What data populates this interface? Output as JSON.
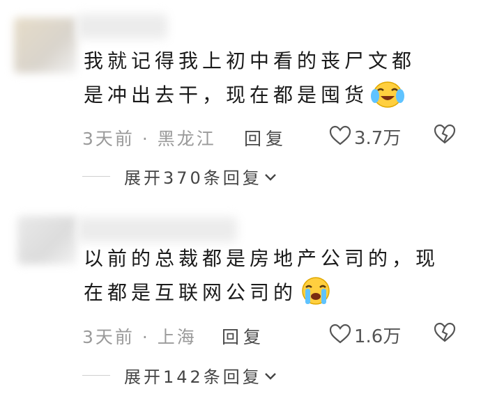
{
  "comments": [
    {
      "line1": "我就记得我上初中看的丧尸文都",
      "line2": "是冲出去干，现在都是囤货",
      "location": "3天前 · 黑龙江",
      "reply_label": "回复",
      "likes": "3.7万",
      "expand_label": "展开370条回复",
      "emoji": "laugh-cry-emoji"
    },
    {
      "line1": "以前的总裁都是房地产公司的，现",
      "line2": "在都是互联网公司的",
      "location": "3天前 · 上海",
      "reply_label": "回复",
      "likes": "1.6万",
      "expand_label": "展开142条回复",
      "emoji": "crying-emoji"
    }
  ]
}
